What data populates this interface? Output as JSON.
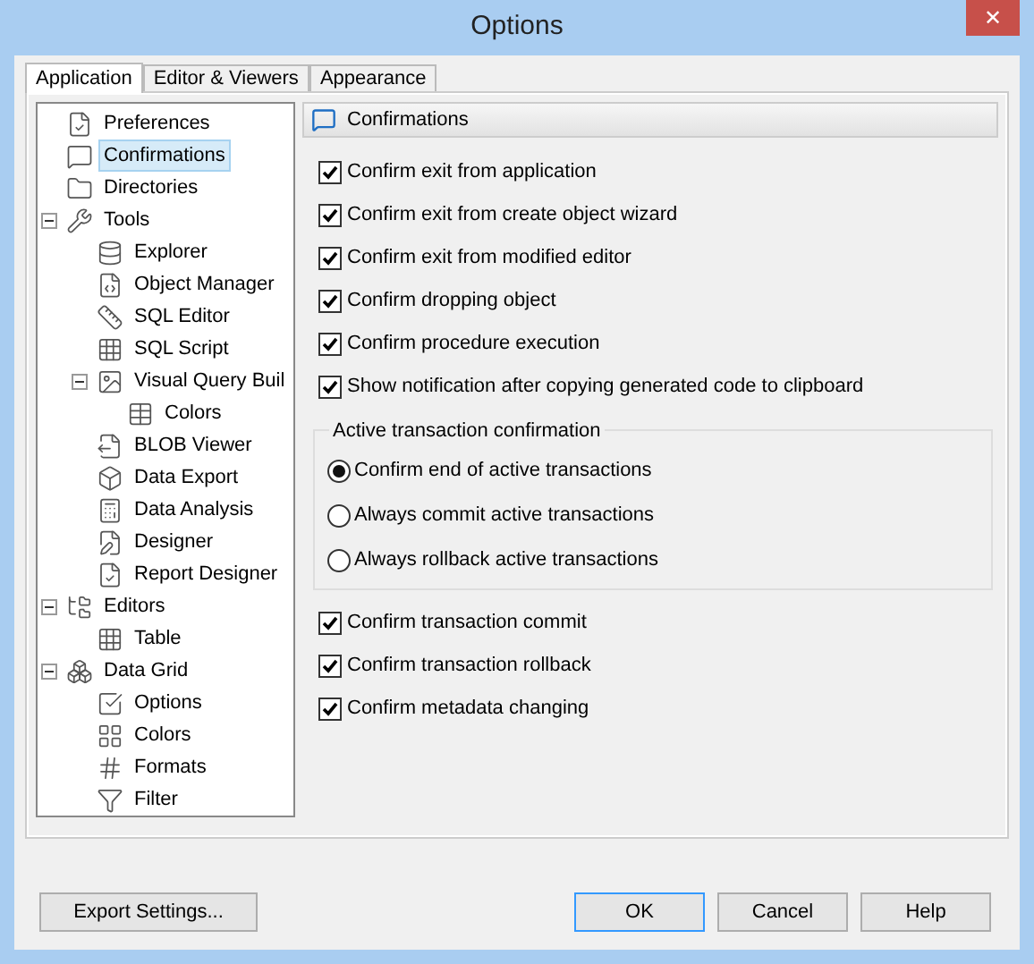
{
  "window": {
    "title": "Options",
    "close": "✕"
  },
  "tabs": [
    {
      "label": "Application",
      "selected": true
    },
    {
      "label": "Editor & Viewers",
      "selected": false
    },
    {
      "label": "Appearance",
      "selected": false
    }
  ],
  "tree": [
    {
      "label": "Preferences",
      "selected": false
    },
    {
      "label": "Confirmations",
      "selected": true
    },
    {
      "label": "Directories",
      "selected": false
    },
    {
      "label": "Tools",
      "selected": false,
      "expanded": true,
      "children": [
        {
          "label": "Explorer",
          "selected": false
        },
        {
          "label": "Object Manager",
          "selected": false
        },
        {
          "label": "SQL Editor",
          "selected": false
        },
        {
          "label": "SQL Script",
          "selected": false
        },
        {
          "label": "Visual Query Buil",
          "selected": false,
          "expanded": true,
          "children": [
            {
              "label": "Colors",
              "selected": false
            }
          ]
        },
        {
          "label": "BLOB Viewer",
          "selected": false
        },
        {
          "label": "Data Export",
          "selected": false
        },
        {
          "label": "Data Analysis",
          "selected": false
        },
        {
          "label": "Designer",
          "selected": false
        },
        {
          "label": "Report Designer",
          "selected": false
        }
      ]
    },
    {
      "label": "Editors",
      "selected": false,
      "expanded": true,
      "children": [
        {
          "label": "Table",
          "selected": false
        }
      ]
    },
    {
      "label": "Data Grid",
      "selected": false,
      "expanded": true,
      "children": [
        {
          "label": "Options",
          "selected": false
        },
        {
          "label": "Colors",
          "selected": false
        },
        {
          "label": "Formats",
          "selected": false
        },
        {
          "label": "Filter",
          "selected": false
        }
      ]
    }
  ],
  "panel": {
    "title": "Confirmations"
  },
  "checks_top": [
    {
      "label": "Confirm exit from application",
      "checked": true
    },
    {
      "label": "Confirm exit from create object wizard",
      "checked": true
    },
    {
      "label": "Confirm exit from modified editor",
      "checked": true
    },
    {
      "label": "Confirm dropping object",
      "checked": true
    },
    {
      "label": "Confirm procedure execution",
      "checked": true
    },
    {
      "label": "Show notification after copying generated code to clipboard",
      "checked": true
    }
  ],
  "group": {
    "title": "Active transaction confirmation",
    "options": [
      {
        "label": "Confirm end of active transactions",
        "selected": true
      },
      {
        "label": "Always commit active transactions",
        "selected": false
      },
      {
        "label": "Always rollback active transactions",
        "selected": false
      }
    ]
  },
  "checks_bottom": [
    {
      "label": "Confirm transaction commit",
      "checked": true
    },
    {
      "label": "Confirm transaction rollback",
      "checked": true
    },
    {
      "label": "Confirm metadata changing",
      "checked": true
    }
  ],
  "buttons": {
    "export": "Export Settings...",
    "ok": "OK",
    "cancel": "Cancel",
    "help": "Help"
  }
}
